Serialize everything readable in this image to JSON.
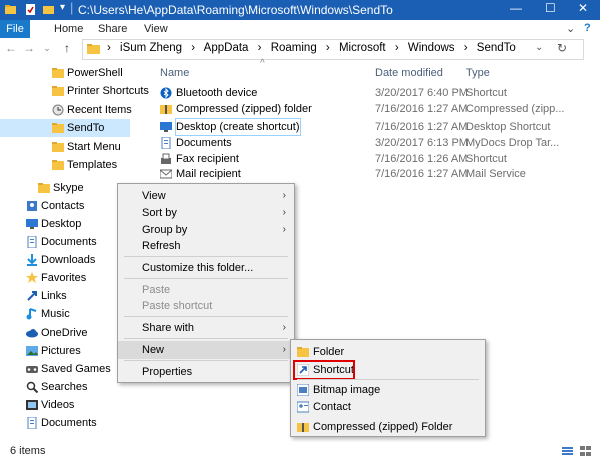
{
  "window": {
    "title": "C:\\Users\\He\\AppData\\Roaming\\Microsoft\\Windows\\SendTo",
    "controls": {
      "minimize": "—",
      "maximize": "☐",
      "close": "✕"
    },
    "accent": "#1a5fb4"
  },
  "ribbon": {
    "tabs": [
      "File",
      "Home",
      "Share",
      "View"
    ],
    "expand": "⌄",
    "help": "?"
  },
  "address": {
    "crumbs": [
      "iSum Zheng",
      "AppData",
      "Roaming",
      "Microsoft",
      "Windows",
      "SendTo"
    ],
    "separator": "›",
    "back": "←",
    "forward": "→",
    "recent": "⌄",
    "up": "↑",
    "dropdown": "⌄",
    "refresh": "↻"
  },
  "nav": {
    "items": [
      {
        "label": "PowerShell",
        "icon": "folder-icon"
      },
      {
        "label": "Printer Shortcuts",
        "icon": "folder-icon"
      },
      {
        "label": "Recent Items",
        "icon": "recent-icon"
      },
      {
        "label": "SendTo",
        "icon": "folder-icon",
        "selected": true
      },
      {
        "label": "Start Menu",
        "icon": "folder-icon"
      },
      {
        "label": "Templates",
        "icon": "folder-icon"
      },
      {
        "label": "Skype",
        "icon": "folder-icon"
      },
      {
        "label": "Contacts",
        "icon": "contacts-icon"
      },
      {
        "label": "Desktop",
        "icon": "desktop-icon"
      },
      {
        "label": "Documents",
        "icon": "documents-icon"
      },
      {
        "label": "Downloads",
        "icon": "downloads-icon"
      },
      {
        "label": "Favorites",
        "icon": "favorites-icon"
      },
      {
        "label": "Links",
        "icon": "links-icon"
      },
      {
        "label": "Music",
        "icon": "music-icon"
      },
      {
        "label": "OneDrive",
        "icon": "onedrive-icon"
      },
      {
        "label": "Pictures",
        "icon": "pictures-icon"
      },
      {
        "label": "Saved Games",
        "icon": "saved-games-icon"
      },
      {
        "label": "Searches",
        "icon": "searches-icon"
      },
      {
        "label": "Videos",
        "icon": "videos-icon"
      },
      {
        "label": "Documents",
        "icon": "documents-icon"
      }
    ]
  },
  "columns": {
    "name": "Name",
    "date": "Date modified",
    "type": "Type",
    "sort_indicator": "^"
  },
  "files": [
    {
      "name": "Bluetooth device",
      "date": "3/20/2017 6:40 PM",
      "type": "Shortcut",
      "icon": "bluetooth-icon"
    },
    {
      "name": "Compressed (zipped) folder",
      "date": "7/16/2016 1:27 AM",
      "type": "Compressed (zipp...",
      "icon": "zip-folder-icon"
    },
    {
      "name": "Desktop (create shortcut)",
      "date": "7/16/2016 1:27 AM",
      "type": "Desktop Shortcut",
      "icon": "desktop-icon",
      "selected": true
    },
    {
      "name": "Documents",
      "date": "3/20/2017 6:13 PM",
      "type": "MyDocs Drop Tar...",
      "icon": "documents-icon"
    },
    {
      "name": "Fax recipient",
      "date": "7/16/2016 1:26 AM",
      "type": "Shortcut",
      "icon": "fax-icon"
    },
    {
      "name": "Mail recipient",
      "date": "7/16/2016 1:27 AM",
      "type": "Mail Service",
      "icon": "mail-icon"
    }
  ],
  "context_menu": {
    "items": [
      {
        "label": "View",
        "arrow": "›"
      },
      {
        "label": "Sort by",
        "arrow": "›"
      },
      {
        "label": "Group by",
        "arrow": "›"
      },
      {
        "label": "Refresh"
      },
      {
        "label": "Customize this folder..."
      },
      {
        "label": "Paste",
        "disabled": true
      },
      {
        "label": "Paste shortcut",
        "disabled": true
      },
      {
        "label": "Share with",
        "arrow": "›"
      },
      {
        "label": "New",
        "arrow": "›",
        "highlighted": true
      },
      {
        "label": "Properties"
      }
    ]
  },
  "submenu": {
    "items": [
      {
        "label": "Folder",
        "icon": "folder-icon"
      },
      {
        "label": "Shortcut",
        "icon": "shortcut-icon",
        "boxed": true
      },
      {
        "label": "Bitmap image",
        "icon": "bitmap-icon"
      },
      {
        "label": "Contact",
        "icon": "contact-card-icon"
      },
      {
        "label": "Compressed (zipped) Folder",
        "icon": "zip-folder-icon"
      }
    ]
  },
  "status": {
    "count": "6 items"
  }
}
